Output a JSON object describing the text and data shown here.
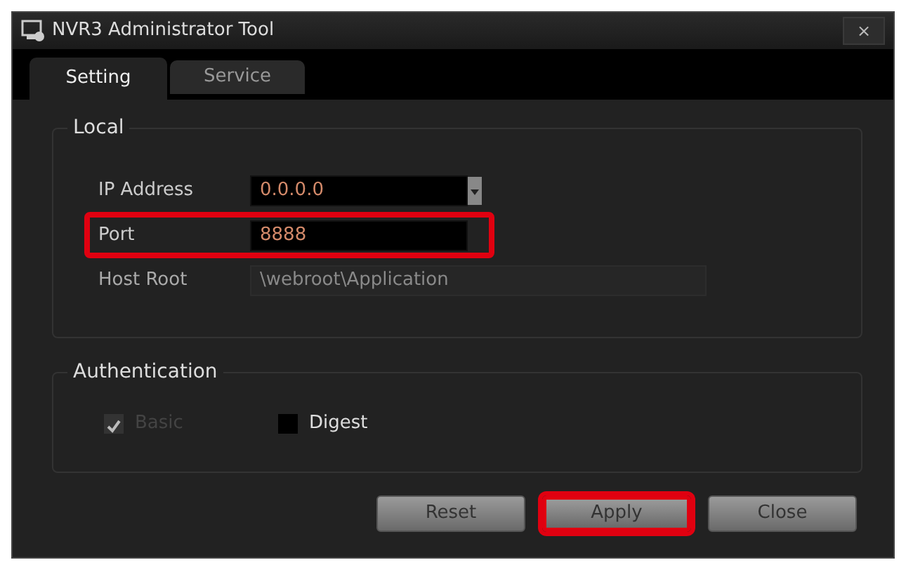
{
  "window": {
    "title": "NVR3 Administrator Tool",
    "close": "×"
  },
  "tabs": [
    {
      "label": "Setting",
      "selected": true
    },
    {
      "label": "Service",
      "selected": false
    }
  ],
  "local": {
    "title": "Local",
    "fields": [
      {
        "label": "IP Address",
        "value": "0.0.0.0",
        "kind": "dropdown",
        "disabled": false
      },
      {
        "label": "Port",
        "value": "8888",
        "kind": "text",
        "disabled": false,
        "highlighted": true
      },
      {
        "label": "Host Root",
        "value": "\\webroot\\Application",
        "kind": "text",
        "disabled": true
      }
    ]
  },
  "authentication": {
    "title": "Authentication",
    "options": [
      {
        "label": "Basic",
        "checked": true,
        "disabled": true
      },
      {
        "label": "Digest",
        "checked": false,
        "disabled": false
      }
    ]
  },
  "buttons": [
    {
      "label": "Reset",
      "highlighted": false
    },
    {
      "label": "Apply",
      "highlighted": true
    },
    {
      "label": "Close",
      "highlighted": false
    }
  ]
}
